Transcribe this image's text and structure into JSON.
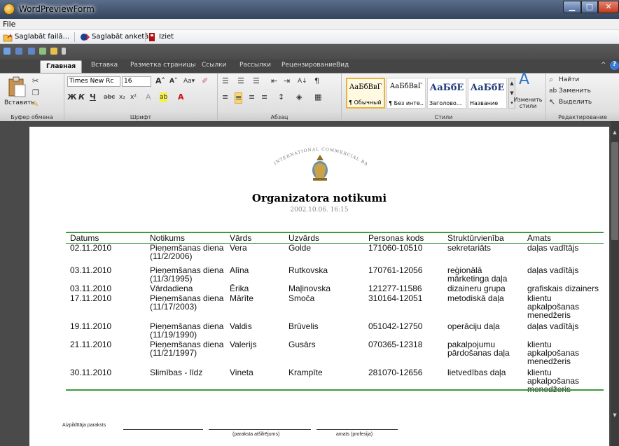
{
  "window": {
    "title": "WordPreviewForm"
  },
  "menu": {
    "file": "File"
  },
  "toolbar": {
    "save_file": "Saglabāt failā...",
    "save_form": "Saglabāt anketā...",
    "exit": "Iziet"
  },
  "ribbon": {
    "tabs": [
      "Главная",
      "Вставка",
      "Разметка страницы",
      "Ссылки",
      "Рассылки",
      "Рецензирование",
      "Вид"
    ],
    "clipboard": {
      "paste": "Вставить",
      "label": "Буфер обмена"
    },
    "font": {
      "name": "Times New Rc",
      "size": "16",
      "label": "Шрифт"
    },
    "paragraph": {
      "label": "Абзац"
    },
    "styles": {
      "items": [
        {
          "sample": "АаБбВвГ",
          "name": "¶ Обычный"
        },
        {
          "sample": "АаБбВвГ",
          "name": "¶ Без инте..."
        },
        {
          "sample": "АаБбЕ",
          "name": "Заголово..."
        },
        {
          "sample": "АаБбЕ",
          "name": "Название"
        }
      ],
      "change": "Изменить стили",
      "label": "Стили"
    },
    "editing": {
      "find": "Найти",
      "replace": "Заменить",
      "select": "Выделить",
      "label": "Редактирование"
    }
  },
  "document": {
    "bank_name": "INTERNATIONAL COMMERCIAL BANK",
    "title": "Organizatora notikumi",
    "date": "2002.10.06. 16:15",
    "columns": [
      "Datums",
      "Notikums",
      "Vārds",
      "Uzvārds",
      "Personas kods",
      "Struktūrvienība",
      "Amats"
    ],
    "rows": [
      {
        "date": "02.11.2010",
        "event": [
          "Pieņemšanas diena",
          "(11/2/2006)"
        ],
        "name": "Vera",
        "surname": "Golde",
        "code": "171060-10510",
        "unit": [
          "sekretariāts"
        ],
        "position": [
          "daļas vadītājs"
        ]
      },
      {
        "date": "03.11.2010",
        "event": [
          "Pieņemšanas diena",
          "(11/3/1995)"
        ],
        "name": "Alīna",
        "surname": "Rutkovska",
        "code": "170761-12056",
        "unit": [
          "reģionālā",
          "mārketinga daļa"
        ],
        "position": [
          "daļas vadītājs"
        ]
      },
      {
        "date": "03.11.2010",
        "event": [
          "Vārdadiena"
        ],
        "name": "Ērika",
        "surname": "Maļinovska",
        "code": "121277-11586",
        "unit": [
          "dizaineru grupa"
        ],
        "position": [
          "grafiskais dizainers"
        ]
      },
      {
        "date": "17.11.2010",
        "event": [
          "Pieņemšanas diena",
          "(11/17/2003)"
        ],
        "name": "Mārīte",
        "surname": "Smoča",
        "code": "310164-12051",
        "unit": [
          "metodiskā daļa"
        ],
        "position": [
          "klientu",
          "apkalpošanas",
          "menedžeris"
        ]
      },
      {
        "date": "19.11.2010",
        "event": [
          "Pieņemšanas diena",
          "(11/19/1990)"
        ],
        "name": "Valdis",
        "surname": "Brūvelis",
        "code": "051042-12750",
        "unit": [
          "operāciju daļa"
        ],
        "position": [
          "daļas vadītājs"
        ]
      },
      {
        "date": "21.11.2010",
        "event": [
          "Pieņemšanas diena",
          "(11/21/1997)"
        ],
        "name": "Valerijs",
        "surname": "Gusārs",
        "code": "070365-12318",
        "unit": [
          "pakalpojumu",
          "pārdošanas daļa"
        ],
        "position": [
          "klientu",
          "apkalpošanas",
          "menedžeris"
        ]
      },
      {
        "date": "30.11.2010",
        "event": [
          "Slimības - līdz"
        ],
        "name": "Vineta",
        "surname": "Krampīte",
        "code": "281070-12656",
        "unit": [
          "lietvedības daļa"
        ],
        "position": [
          "klientu",
          "apkalpošanas",
          "menedžeris"
        ]
      }
    ],
    "signature": {
      "label": "Aizpildītāja paraksts",
      "decode": "(paraksta atšifrējums)",
      "position": "amats (profesija)"
    }
  }
}
